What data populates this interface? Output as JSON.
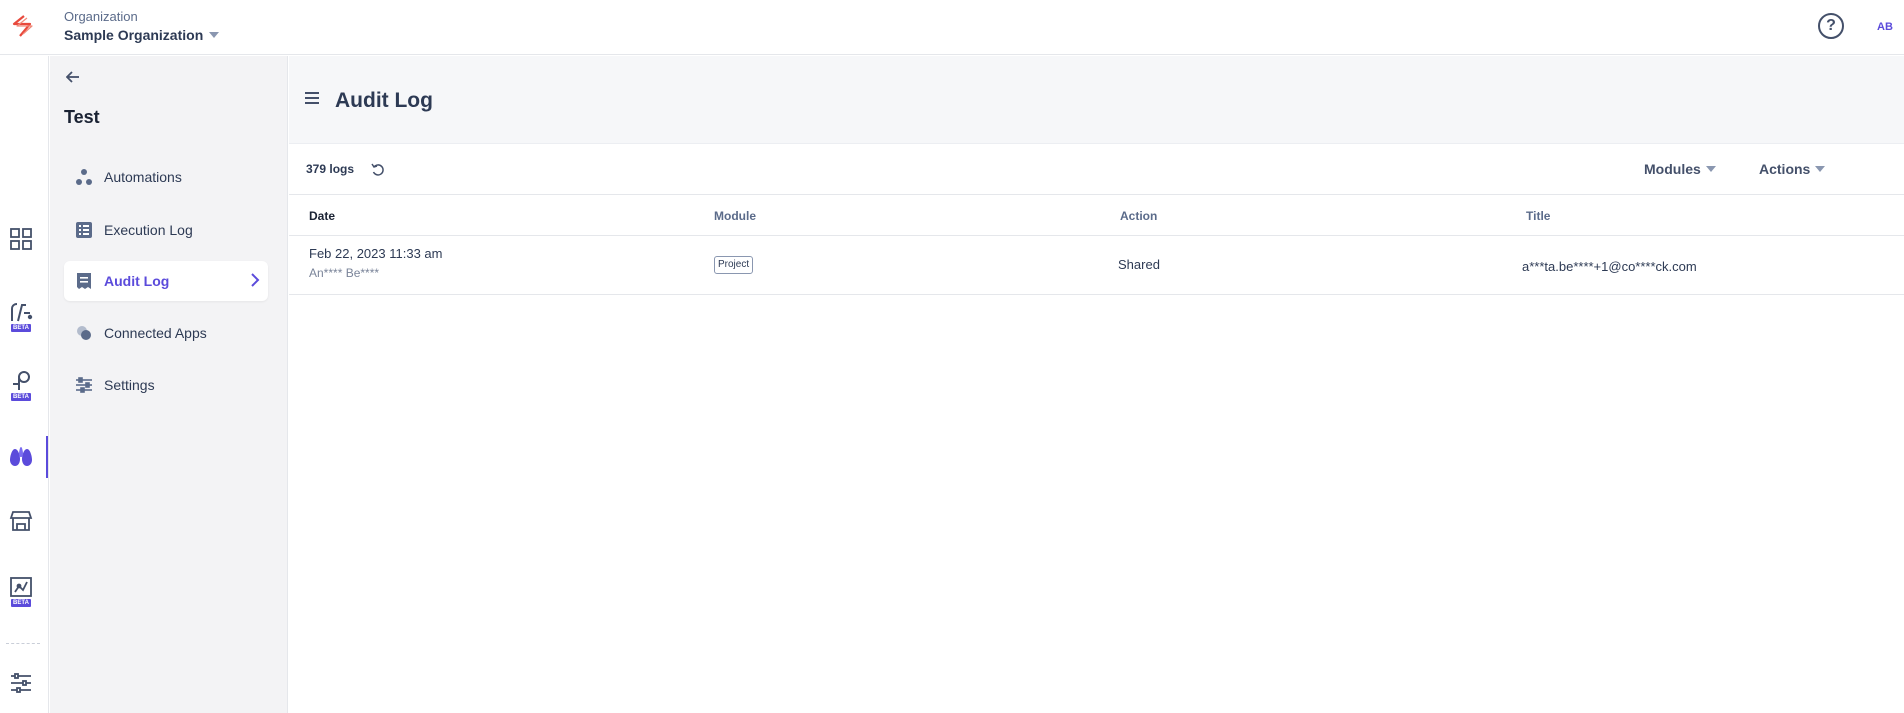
{
  "topbar": {
    "org_label": "Organization",
    "org_name": "Sample Organization",
    "help_symbol": "?",
    "avatar_initials": "AB",
    "brand_color": "#e8493c"
  },
  "rail": {
    "items": [
      {
        "icon": "dashboard-grid-icon"
      },
      {
        "icon": "functions-icon",
        "badge": "BETA"
      },
      {
        "icon": "integrations-icon",
        "badge": "BETA"
      },
      {
        "icon": "scenarios-icon",
        "active": true
      },
      {
        "icon": "marketplace-store-icon"
      },
      {
        "icon": "maps-icon",
        "badge": "BETA"
      },
      {
        "icon": "settings-sliders-icon"
      }
    ],
    "accent_color": "#5b4bdb"
  },
  "sidebar": {
    "project_title": "Test",
    "items": [
      {
        "label": "Automations",
        "icon": "automations-icon"
      },
      {
        "label": "Execution Log",
        "icon": "execution-log-icon"
      },
      {
        "label": "Audit Log",
        "icon": "audit-log-icon",
        "active": true
      },
      {
        "label": "Connected Apps",
        "icon": "connected-apps-icon"
      },
      {
        "label": "Settings",
        "icon": "settings-icon"
      }
    ]
  },
  "main": {
    "title": "Audit Log",
    "log_count": "379 logs",
    "filters": {
      "modules": "Modules",
      "actions": "Actions"
    },
    "table": {
      "headers": {
        "date": "Date",
        "module": "Module",
        "action": "Action",
        "title": "Title"
      },
      "rows": [
        {
          "date": "Feb 22, 2023 11:33 am",
          "user": "An**** Be****",
          "module": "Project",
          "action": "Shared",
          "title": "a***ta.be****+1@co****ck.com"
        }
      ]
    }
  }
}
